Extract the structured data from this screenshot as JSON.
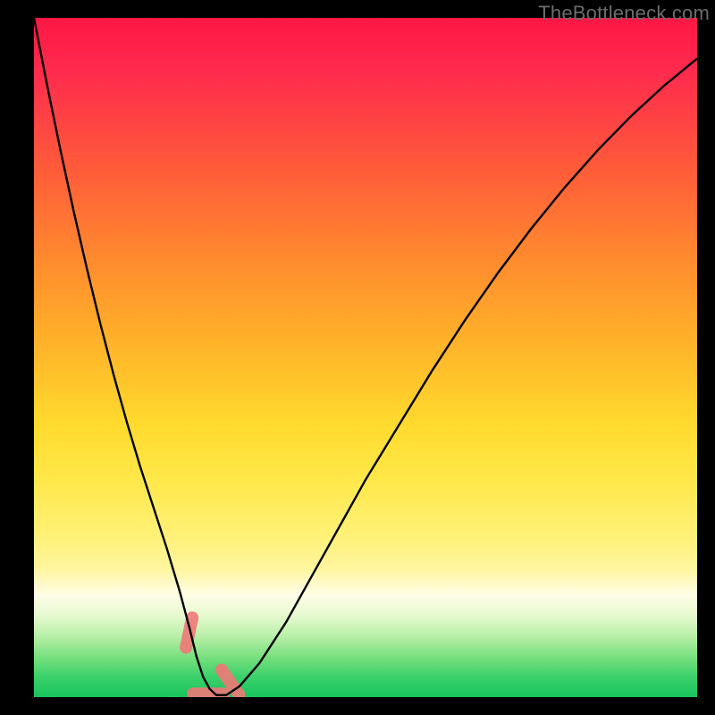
{
  "watermark": "TheBottleneck.com",
  "chart_data": {
    "type": "line",
    "title": "",
    "xlabel": "",
    "ylabel": "",
    "xlim": [
      0,
      100
    ],
    "ylim": [
      0,
      100
    ],
    "grid": false,
    "legend": false,
    "series": [
      {
        "name": "bottleneck-curve",
        "x": [
          0,
          2,
          4,
          6,
          8,
          10,
          12,
          14,
          16,
          18,
          20,
          22,
          23.5,
          24.5,
          25.5,
          26.5,
          27.5,
          29,
          31,
          34,
          38,
          42,
          46,
          50,
          55,
          60,
          65,
          70,
          75,
          80,
          85,
          90,
          95,
          100
        ],
        "y": [
          100,
          90,
          80.5,
          71.5,
          63,
          55,
          47.5,
          40.5,
          34,
          28,
          22,
          15.5,
          10,
          6,
          3,
          1.2,
          0.3,
          0.3,
          1.6,
          5,
          11,
          18,
          25,
          32,
          40,
          48,
          55.5,
          62.5,
          69,
          75,
          80.5,
          85.5,
          90,
          94
        ]
      }
    ],
    "highlights": [
      {
        "name": "left-marker",
        "cx": 23.4,
        "cy": 9.5,
        "angle": 78
      },
      {
        "name": "bottom-marker",
        "cx": 26.3,
        "cy": 0.5,
        "angle": 0
      },
      {
        "name": "right-marker",
        "cx": 29.6,
        "cy": 2.2,
        "angle": -55
      }
    ],
    "colors": {
      "curve": "#000000",
      "highlight": "#f07878"
    }
  }
}
